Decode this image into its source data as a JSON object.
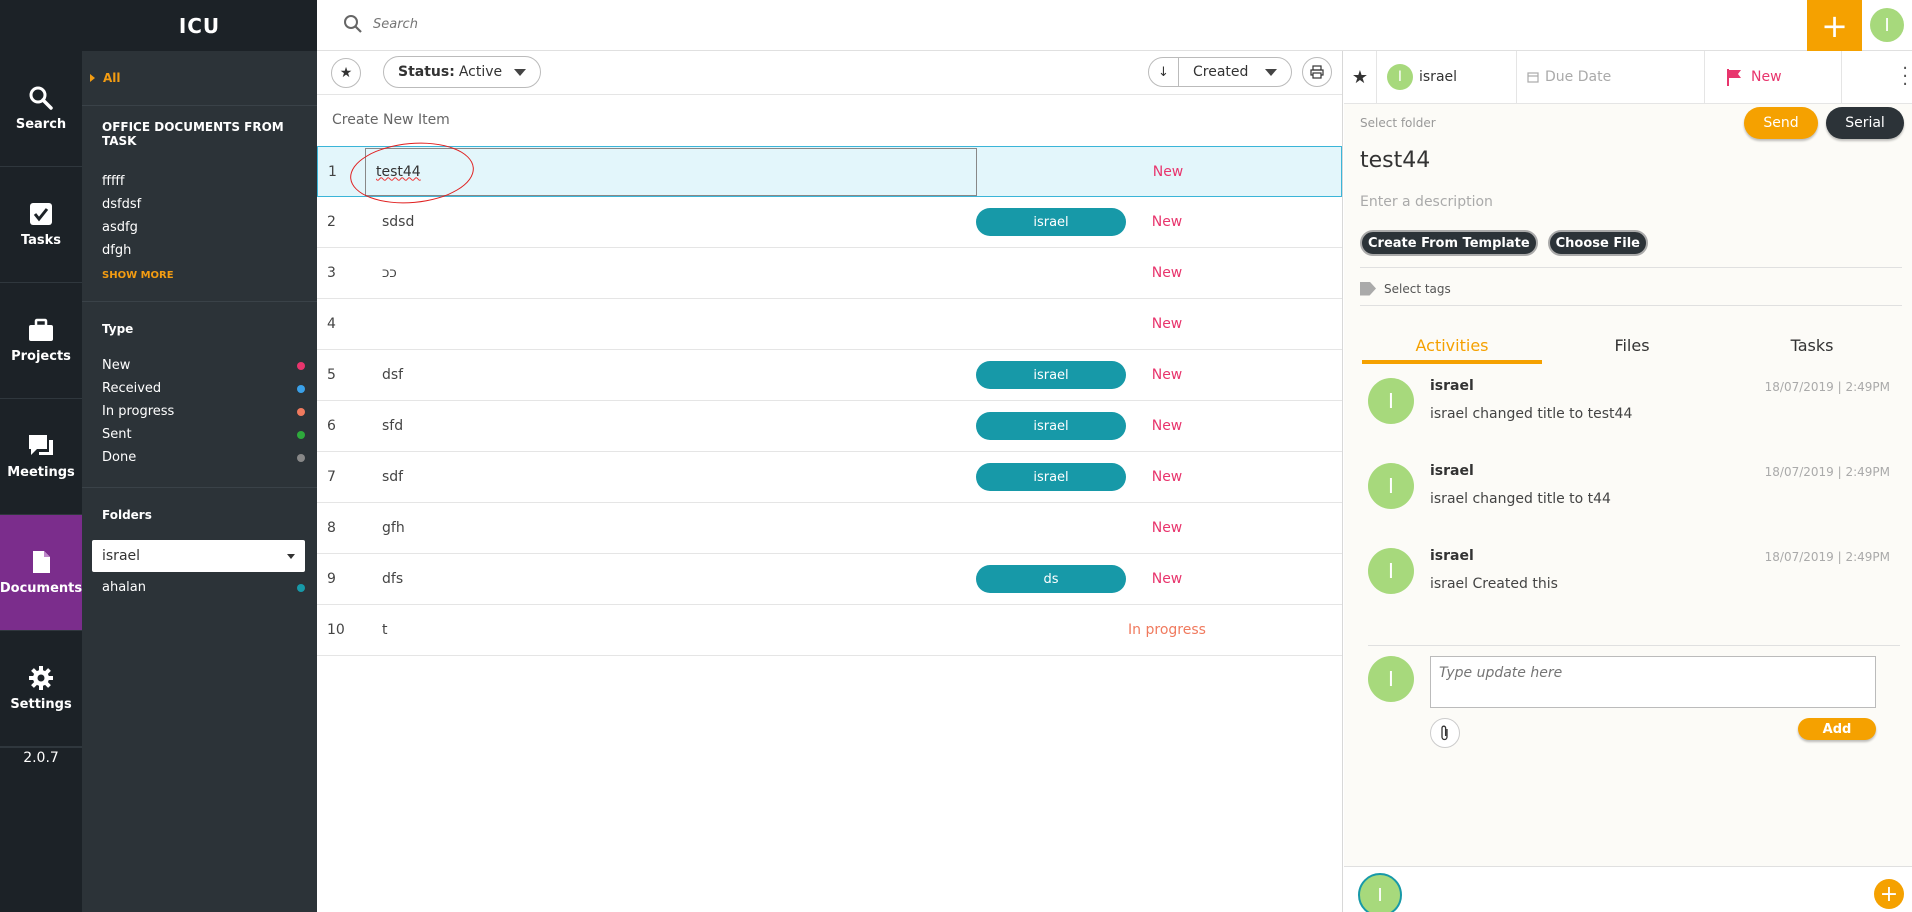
{
  "app": {
    "title": "ICU",
    "version": "2.0.7"
  },
  "nav": [
    {
      "label": "Search",
      "icon": "search-icon"
    },
    {
      "label": "Tasks",
      "icon": "checkbox-icon"
    },
    {
      "label": "Projects",
      "icon": "briefcase-icon"
    },
    {
      "label": "Meetings",
      "icon": "chat-icon"
    },
    {
      "label": "Documents",
      "icon": "document-icon"
    },
    {
      "label": "Settings",
      "icon": "gear-icon"
    }
  ],
  "sidebar": {
    "all_label": "All",
    "office_title": "OFFICE DOCUMENTS FROM TASK",
    "office_items": [
      "fffff",
      "dsfdsf",
      "asdfg",
      "dfgh"
    ],
    "show_more": "SHOW MORE",
    "type_title": "Type",
    "types": [
      {
        "label": "New",
        "color": "#e8356d"
      },
      {
        "label": "Received",
        "color": "#3aa0e8"
      },
      {
        "label": "In progress",
        "color": "#f07a5e"
      },
      {
        "label": "Sent",
        "color": "#2eaa3c"
      },
      {
        "label": "Done",
        "color": "#888888"
      }
    ],
    "folders_title": "Folders",
    "folder_selected": "israel",
    "folder_items": [
      {
        "label": "ahalan",
        "color": "#1799a8"
      }
    ]
  },
  "topbar": {
    "search_placeholder": "Search",
    "plus": "+",
    "avatar": "I"
  },
  "toolbar": {
    "status_key": "Status:",
    "status_value": "Active",
    "sort_arrow": "↓",
    "sort_value": "Created"
  },
  "list": {
    "create_new": "Create New Item",
    "rows": [
      {
        "num": "1",
        "title": "test44",
        "assignee": "",
        "status": "New"
      },
      {
        "num": "2",
        "title": "sdsd",
        "assignee": "israel",
        "status": "New"
      },
      {
        "num": "3",
        "title": "ככ",
        "assignee": "",
        "status": "New"
      },
      {
        "num": "4",
        "title": "",
        "assignee": "",
        "status": "New"
      },
      {
        "num": "5",
        "title": "dsf",
        "assignee": "israel",
        "status": "New"
      },
      {
        "num": "6",
        "title": "sfd",
        "assignee": "israel",
        "status": "New"
      },
      {
        "num": "7",
        "title": "sdf",
        "assignee": "israel",
        "status": "New"
      },
      {
        "num": "8",
        "title": "gfh",
        "assignee": "",
        "status": "New"
      },
      {
        "num": "9",
        "title": "dfs",
        "assignee": "ds",
        "status": "New"
      },
      {
        "num": "10",
        "title": "t",
        "assignee": "",
        "status": "In progress"
      }
    ]
  },
  "detail": {
    "assignee": "israel",
    "assignee_initial": "I",
    "due_date": "Due Date",
    "status": "New",
    "select_folder": "Select folder",
    "send": "Send",
    "serial": "Serial",
    "title": "test44",
    "description_placeholder": "Enter a description",
    "create_template": "Create From Template",
    "choose_file": "Choose File",
    "select_tags": "Select tags",
    "tabs": [
      "Activities",
      "Files",
      "Tasks"
    ],
    "activities": [
      {
        "user": "israel",
        "time": "18/07/2019 | 2:49PM",
        "text": "israel changed title to test44"
      },
      {
        "user": "israel",
        "time": "18/07/2019 | 2:49PM",
        "text": "israel changed title to t44"
      },
      {
        "user": "israel",
        "time": "18/07/2019 | 2:49PM",
        "text": "israel Created this"
      }
    ],
    "update_placeholder": "Type update here",
    "add": "Add"
  }
}
